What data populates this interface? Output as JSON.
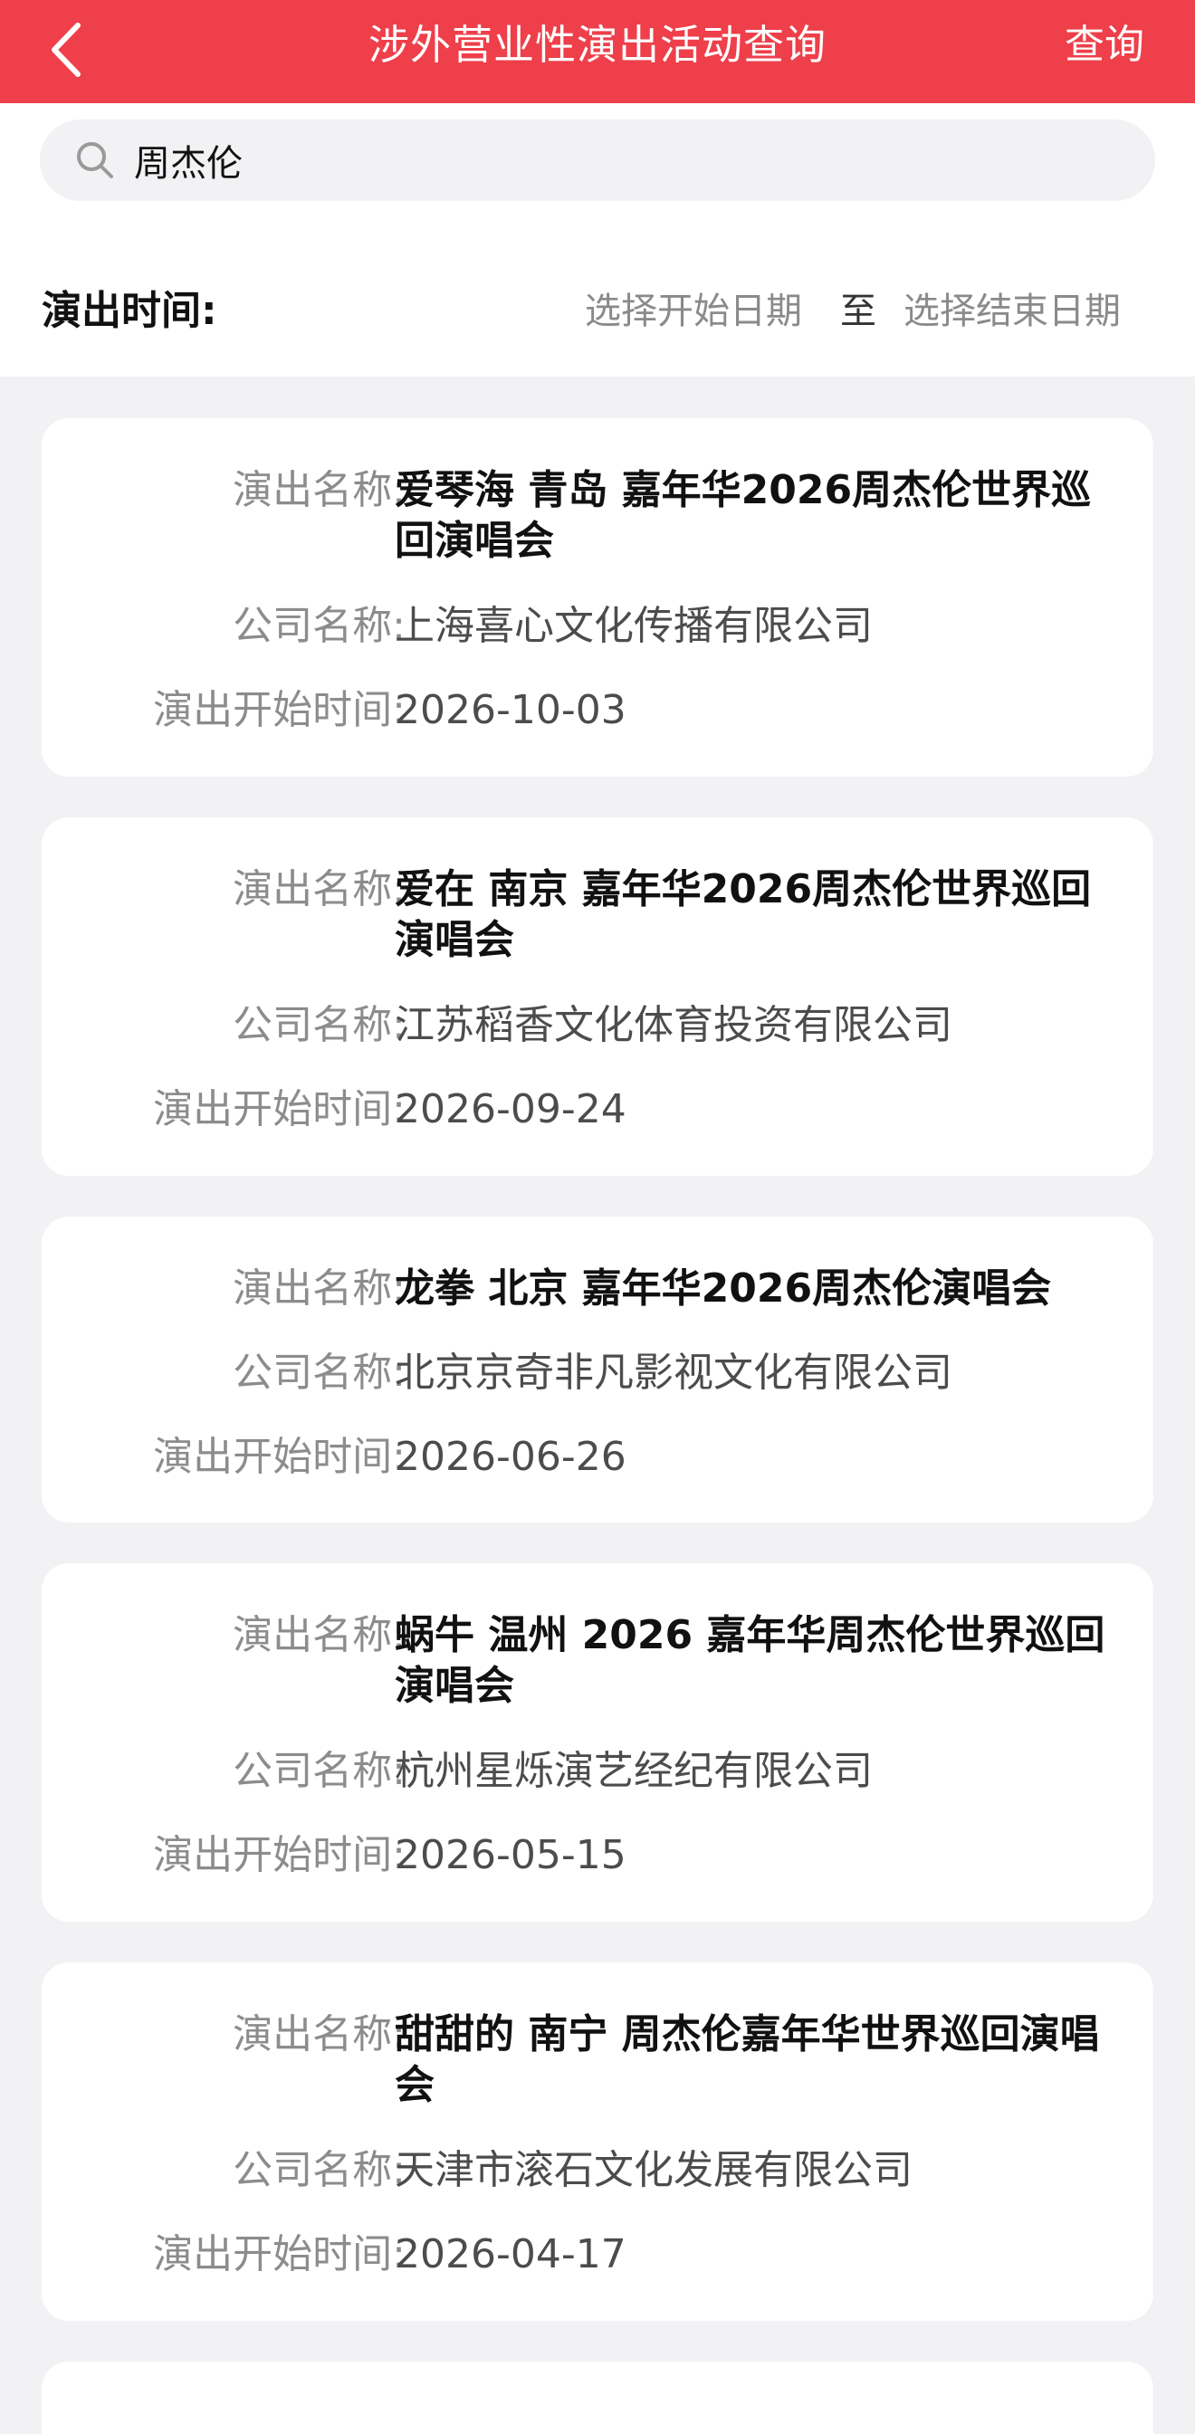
{
  "nav": {
    "title": "涉外营业性演出活动查询",
    "query_label": "查询"
  },
  "search": {
    "value": "周杰伦",
    "placeholder": ""
  },
  "date_filter": {
    "label": "演出时间:",
    "start_placeholder": "选择开始日期",
    "separator": "至",
    "end_placeholder": "选择结束日期"
  },
  "field_labels": {
    "name": "演出名称:",
    "company": "公司名称:",
    "start": "演出开始时间:"
  },
  "results": [
    {
      "name": "爱琴海 青岛 嘉年华2026周杰伦世界巡回演唱会",
      "company": "上海喜心文化传播有限公司",
      "start": "2026-10-03"
    },
    {
      "name": "爱在 南京 嘉年华2026周杰伦世界巡回演唱会",
      "company": "江苏稻香文化体育投资有限公司",
      "start": "2026-09-24"
    },
    {
      "name": "龙拳  北京  嘉年华2026周杰伦演唱会",
      "company": "北京京奇非凡影视文化有限公司",
      "start": "2026-06-26"
    },
    {
      "name": "蜗牛 温州 2026 嘉年华周杰伦世界巡回演唱会",
      "company": "杭州星烁演艺经纪有限公司",
      "start": "2026-05-15"
    },
    {
      "name": "甜甜的 南宁 周杰伦嘉年华世界巡回演唱会",
      "company": "天津市滚石文化发展有限公司",
      "start": "2026-04-17"
    }
  ],
  "colors": {
    "brand": "#ee3f4a",
    "background": "#f2f2f4",
    "card": "#ffffff",
    "label": "#8c8c8c",
    "placeholder": "#8a8a8a"
  }
}
